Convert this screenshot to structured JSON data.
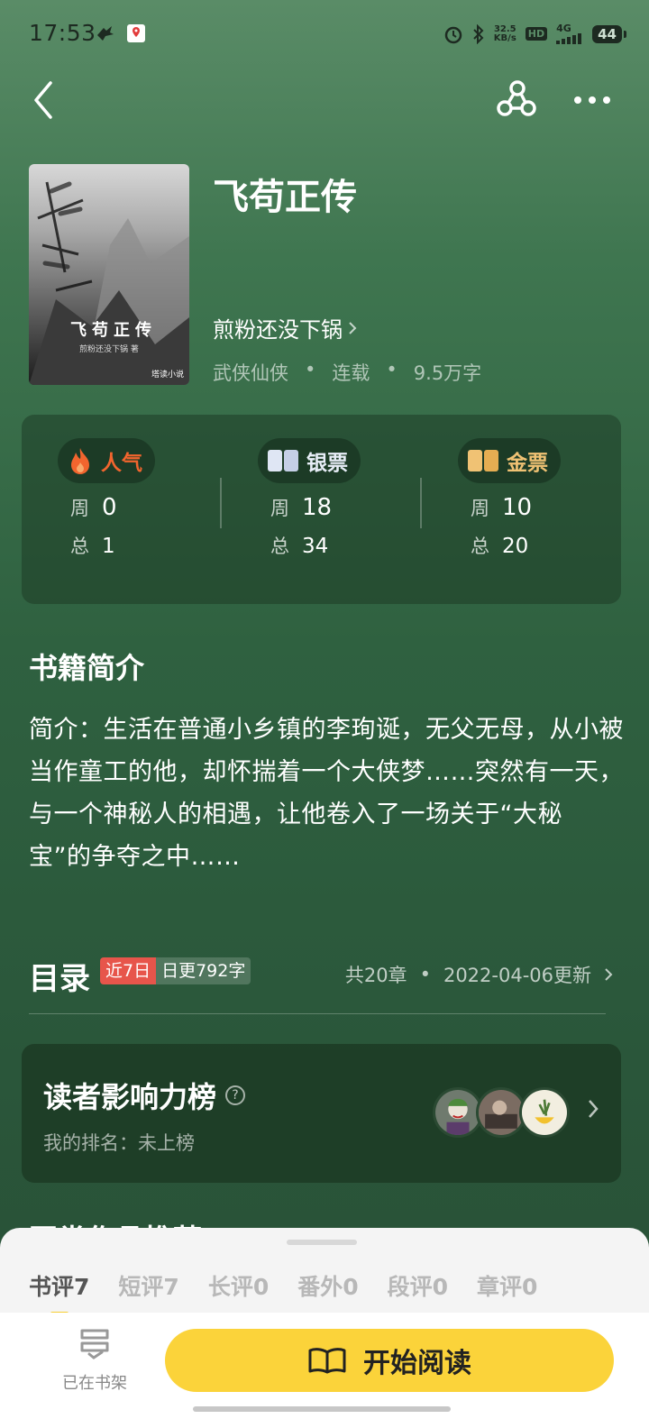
{
  "status_bar": {
    "time": "17:53",
    "net_speed_value": "32.5",
    "net_speed_unit": "KB/s",
    "hd": "HD",
    "signal": "4G",
    "battery": "44"
  },
  "book": {
    "title": "飞苟正传",
    "author": "煎粉还没下锅",
    "genre": "武侠仙侠",
    "status": "连载",
    "word_count": "9.5万字",
    "cover_title": "飞苟正传",
    "cover_author": "煎粉还没下锅 著",
    "cover_publisher": "塔读小说"
  },
  "stats": [
    {
      "label": "人气",
      "week_label": "周",
      "week": "0",
      "total_label": "总",
      "total": "1",
      "color": "#f2652e"
    },
    {
      "label": "银票",
      "week_label": "周",
      "week": "18",
      "total_label": "总",
      "total": "34",
      "color": "#dfe6f4"
    },
    {
      "label": "金票",
      "week_label": "周",
      "week": "10",
      "total_label": "总",
      "total": "20",
      "color": "#f0c274"
    }
  ],
  "intro": {
    "heading": "书籍简介",
    "text": "简介：生活在普通小乡镇的李珣诞，无父无母，从小被当作童工的他，却怀揣着一个大侠梦……突然有一天，与一个神秘人的相遇，让他卷入了一场关于“大秘宝”的争夺之中……"
  },
  "toc": {
    "heading": "目录",
    "badge_recent": "近7日",
    "badge_update": "日更792字",
    "chapters": "共20章",
    "updated": "2022-04-06更新"
  },
  "influence": {
    "title": "读者影响力榜",
    "rank": "我的排名：未上榜"
  },
  "peek_section": "同类作品推荐",
  "tabs": [
    "书评7",
    "短评7",
    "长评0",
    "番外0",
    "段评0",
    "章评0"
  ],
  "bottom": {
    "shelf_label": "已在书架",
    "read_label": "开始阅读"
  },
  "colors": {
    "accent": "#fbd33a",
    "badge_red": "#e7554b",
    "background_top": "#5a8c67",
    "background_bottom": "#284f36"
  }
}
